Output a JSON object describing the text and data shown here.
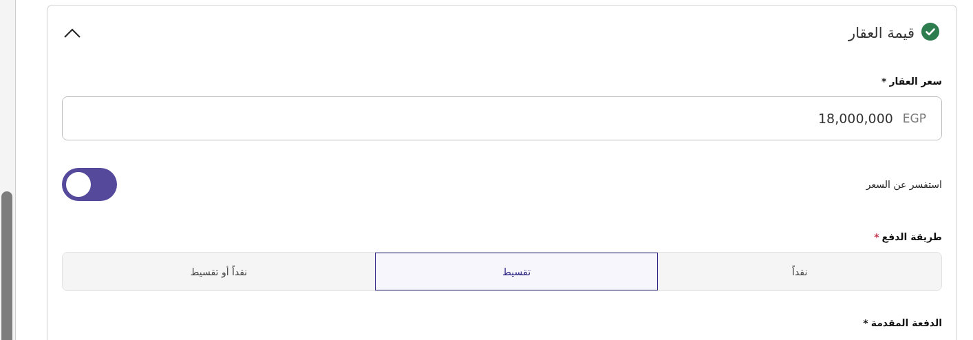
{
  "section": {
    "title": "قيمة العقار",
    "completed": true,
    "expanded": true
  },
  "price_field": {
    "label": "سعر العقار",
    "required_mark": "*",
    "value": "18,000,000",
    "currency": "EGP"
  },
  "ask_price_toggle": {
    "label": "استفسر عن السعر",
    "on": true
  },
  "payment_method": {
    "label": "طريقة الدفع",
    "required_mark": "*",
    "options": [
      {
        "label": "نقداً",
        "selected": false
      },
      {
        "label": "تقسيط",
        "selected": true
      },
      {
        "label": "نقداً أو تقسيط",
        "selected": false
      }
    ]
  },
  "down_payment": {
    "label": "الدفعة المقدمة",
    "required_mark": "*"
  }
}
